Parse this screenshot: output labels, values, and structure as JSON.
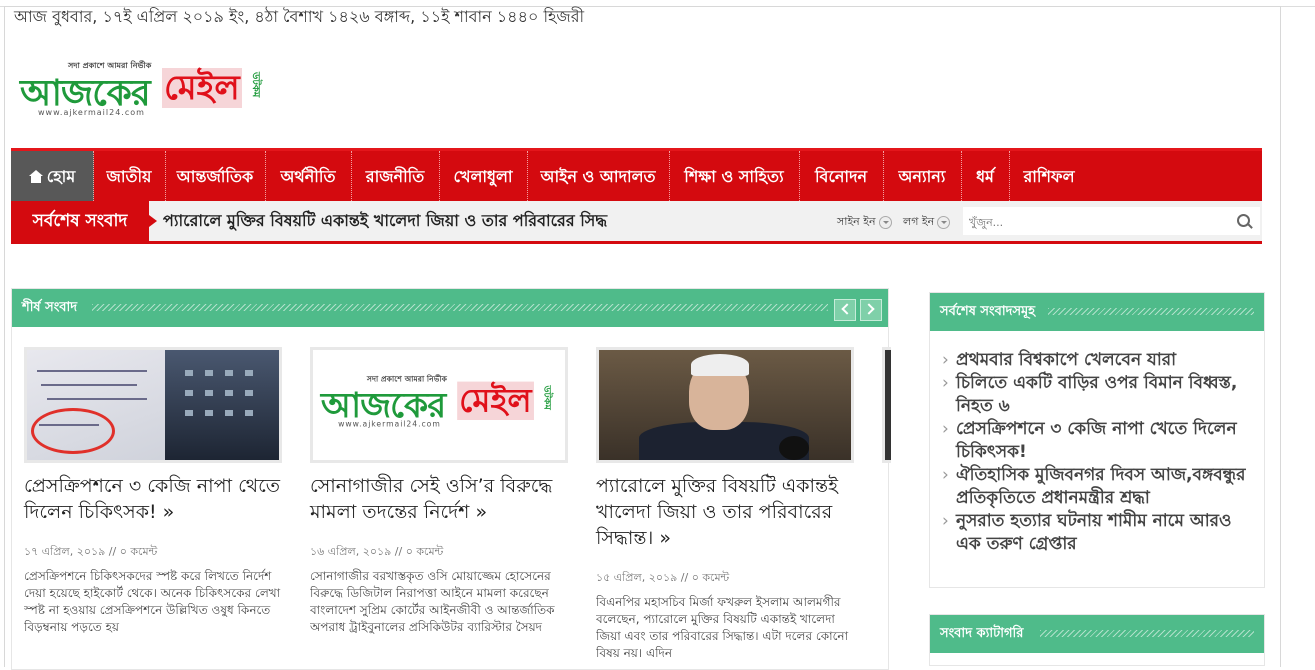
{
  "date_line": "আজ বুধবার, ১৭ই এপ্রিল ২০১৯ ইং, ৪ঠা বৈশাখ ১৪২৬ বঙ্গাব্দ, ১১ই শাবান ১৪৪০ হিজরী",
  "logo": {
    "tagline": "সদা প্রকাশে আমরা নির্ভীক",
    "word1": "আজকের",
    "word2": "মেইল",
    "side": "ডটকম",
    "url": "www.ajkermail24.com"
  },
  "nav": {
    "items": [
      {
        "label": "হোম"
      },
      {
        "label": "জাতীয়"
      },
      {
        "label": "আন্তর্জাতিক"
      },
      {
        "label": "অর্থনীতি"
      },
      {
        "label": "রাজনীতি"
      },
      {
        "label": "খেলাধুলা"
      },
      {
        "label": "আইন ও আদালত"
      },
      {
        "label": "শিক্ষা ও সাহিত্য"
      },
      {
        "label": "বিনোদন"
      },
      {
        "label": "অন্যান্য"
      },
      {
        "label": "ধর্ম"
      },
      {
        "label": "রাশিফল"
      }
    ]
  },
  "ticker": {
    "label": "সর্বশেষ সংবাদ",
    "text": "প্যারোলে মুক্তির বিষয়টি একান্তই খালেদা জিয়া ও তার পরিবারের সিদ্ধ",
    "sign_in": "সাইন ইন",
    "log_in": "লগ ইন",
    "search_placeholder": "খুঁজুন..."
  },
  "main": {
    "title": "শীর্ষ সংবাদ",
    "cards": [
      {
        "title": "প্রেসক্রিপশনে ৩ কেজি নাপা থেতে দিলেন চিকিৎসক! »",
        "date": "১৭ এপ্রিল, ২০১৯",
        "comments": "০ কমেন্ট",
        "excerpt": "প্রেসক্রিপশনে চিকিৎসকদের স্পষ্ট করে লিখতে নির্দেশ দেয়া হয়েছে হাইকোর্ট থেকে। অনেক চিকিৎসকের লেখা স্পষ্ট না হওয়ায় প্রেসক্রিপশনে উল্লিখিত ওষুধ কিনতে বিড়ম্বনায় পড়তে হয়"
      },
      {
        "title": "সোনাগাজীর সেই ওসি’র বিরুদ্ধে মামলা তদন্তের নির্দেশ »",
        "date": "১৬ এপ্রিল, ২০১৯",
        "comments": "০ কমেন্ট",
        "excerpt": "সোনাগাজীর বরখাস্তকৃত ওসি মোয়াজ্জেম হোসেনের বিরুদ্ধে ডিজিটাল নিরাপত্তা আইনে মামলা করেছেন বাংলাদেশ সুপ্রিম কোর্টের আইনজীবী ও আন্তর্জাতিক অপরাধ ট্রাইবুনালের প্রসিকিউটর ব্যারিস্টার সৈয়দ"
      },
      {
        "title": "প্যারোলে মুক্তির বিষয়টি একান্তই খালেদা জিয়া ও তার পরিবারের সিদ্ধান্ত। »",
        "date": "১৫ এপ্রিল, ২০১৯",
        "comments": "০ কমেন্ট",
        "excerpt": "বিএনপির মহাসচিব মির্জা ফখরুল ইসলাম আলমগীর বলেছেন, প্যারোলে মুক্তির বিষয়টি একান্তই খালেদা জিয়া এবং তার পরিবারের সিদ্ধান্ত। এটা দলের কোনো বিষয় নয়। এদিন"
      }
    ]
  },
  "sidebar": {
    "latest_title": "সর্বশেষ সংবাদসমূহ",
    "latest": [
      "প্রথমবার বিশ্বকাপে খেলবেন যারা",
      "চিলিতে একটি বাড়ির ওপর বিমান বিধ্বস্ত, নিহত ৬",
      "প্রেসক্রিপশনে ৩ কেজি নাপা খেতে দিলেন চিকিৎসক!",
      "ঐতিহাসিক মুজিবনগর দিবস আজ,বঙ্গবন্ধুর প্রতিকৃতিতে প্রধানমন্ত্রীর শ্রদ্ধা",
      "নুসরাত হত্যার ঘটনায় শামীম নামে আরও এক তরুণ গ্রেপ্তার"
    ],
    "category_title": "সংবাদ ক্যাটাগরি"
  },
  "colors": {
    "nav_red": "#d40a0f",
    "nav_home": "#585858",
    "green_bar": "#4fbb8a",
    "logo_green": "#1f9a3b"
  }
}
